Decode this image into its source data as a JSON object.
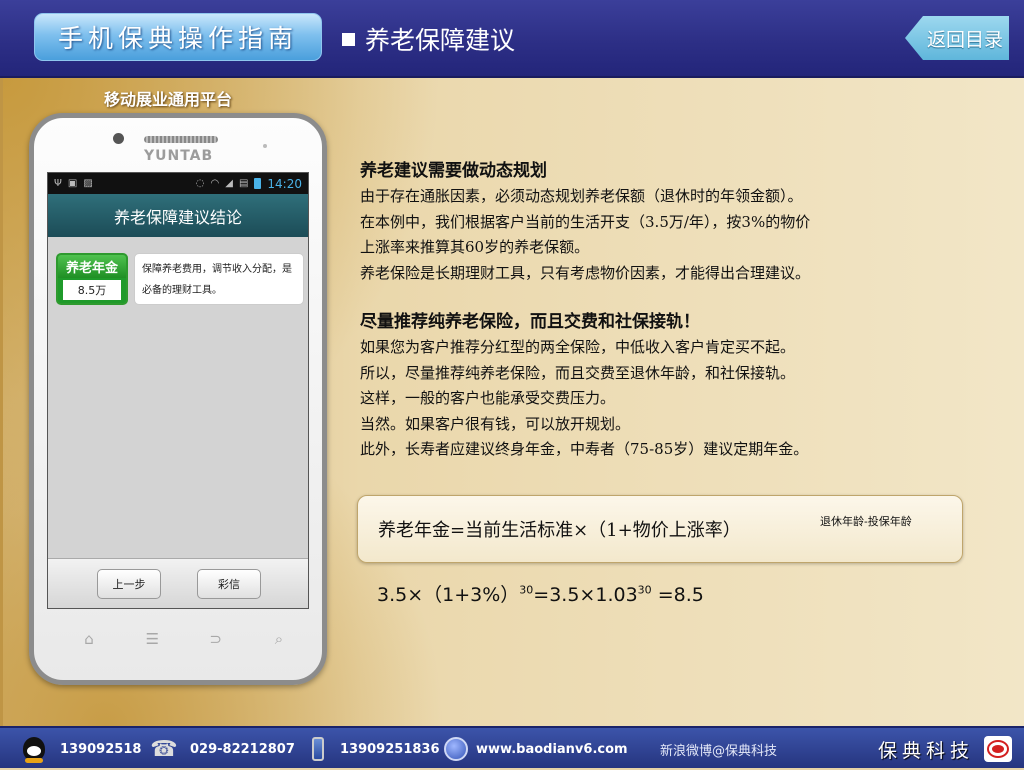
{
  "header": {
    "brand": "手机保典操作指南",
    "section_title": "养老保障建议",
    "back_label": "返回目录"
  },
  "platform_label": "移动展业通用平台",
  "phone": {
    "brand": "YUNTAB",
    "status_time": "14:20",
    "screen_title": "养老保障建议结论",
    "pension_card": {
      "label": "养老年金",
      "value": "8.5万"
    },
    "note": "保障养老费用，调节收入分配，是必备的理财工具。",
    "buttons": {
      "prev": "上一步",
      "mms": "彩信"
    }
  },
  "content": {
    "block1": {
      "heading": "养老建议需要做动态规划",
      "lines": [
        "由于存在通胀因素，必须动态规划养老保额（退休时的年领金额）。",
        "在本例中，我们根据客户当前的生活开支（3.5万/年），按3%的物价",
        "上涨率来推算其60岁的养老保额。",
        "养老保险是长期理财工具，只有考虑物价因素，才能得出合理建议。"
      ]
    },
    "block2": {
      "heading": "尽量推荐纯养老保险，而且交费和社保接轨！",
      "lines": [
        "如果您为客户推荐分红型的两全保险，中低收入客户肯定买不起。",
        "所以，尽量推荐纯养老保险，而且交费至退休年龄，和社保接轨。",
        "这样，一般的客户也能承受交费压力。",
        "当然。如果客户很有钱，可以放开规划。",
        "此外，长寿者应建议终身年金，中寿者（75-85岁）建议定期年金。"
      ]
    },
    "formula": {
      "main": "养老年金=当前生活标准×（1+物价上涨率）",
      "exponent": "退休年龄-投保年龄"
    },
    "calc": {
      "part1": "3.5×（1+3%）",
      "exp1": "30",
      "part2": "=3.5×1.03",
      "exp2": "30",
      "part3": " =8.5"
    }
  },
  "footer": {
    "qq": "139092518",
    "tel": "029-82212807",
    "mobile": "13909251836",
    "website": "www.baodianv6.com",
    "weibo": "新浪微博@保典科技",
    "brand": "保典科技"
  }
}
